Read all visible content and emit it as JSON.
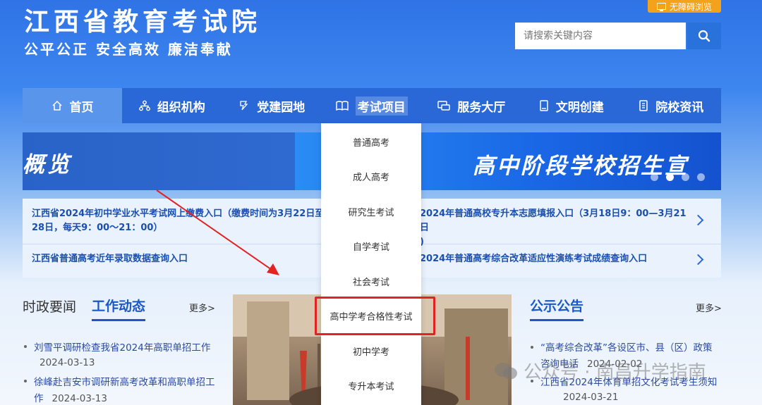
{
  "header": {
    "title": "江西省教育考试院",
    "slogan": "公平公正  安全高效  廉洁奉献",
    "accessibility_label": "无障碍浏览",
    "search_placeholder": "请搜索关键内容"
  },
  "nav": [
    {
      "label": "首页",
      "icon": "home-icon"
    },
    {
      "label": "组织机构",
      "icon": "org-chart-icon"
    },
    {
      "label": "党建园地",
      "icon": "party-building-icon"
    },
    {
      "label": "考试项目",
      "icon": "book-icon"
    },
    {
      "label": "服务大厅",
      "icon": "service-icon"
    },
    {
      "label": "文明创建",
      "icon": "tablet-icon"
    },
    {
      "label": "院校资讯",
      "icon": "document-icon"
    }
  ],
  "banner": {
    "left_text": "概览",
    "right_text": "高中阶段学校招生宣"
  },
  "quick_links": [
    {
      "line1": "江西省2024年初中学业水平考试网上缴费入口（缴费时间为3月22日至",
      "line2": "28日，每天9：00～21：00）"
    },
    {
      "line1": "2024年普通高校专升本志愿填报入口（3月18日9：00—3月21日",
      "line2": ")"
    },
    {
      "line1": "江西省普通高考近年录取数据查询入口",
      "line2": ""
    },
    {
      "line1": "2024年普通高考综合改革适应性演练考试成绩查询入口",
      "line2": ""
    }
  ],
  "news": {
    "tab_inactive": "时政要闻",
    "tab_active": "工作动态",
    "more": "更多>",
    "items": [
      {
        "title": "刘雪平调研检查我省2024年高职单招工作",
        "date": "2024-03-13"
      },
      {
        "title": "徐峰赴吉安市调研新高考改革和高职单招工",
        "title2": "作",
        "date": "2024-03-13"
      }
    ]
  },
  "notices": {
    "title": "公示公告",
    "more": "更多>",
    "items": [
      {
        "title": "“高考综合改革”各设区市、县（区）政策",
        "title2": "咨询电话",
        "date": "2024-02-02"
      },
      {
        "title": "江西省2024年体育单招文化考试考生须知",
        "date": "2024-03-21"
      }
    ]
  },
  "dropdown": {
    "items": [
      "普通高考",
      "成人高考",
      "研究生考试",
      "自学考试",
      "社会考试",
      "高中学考合格性考试",
      "初中学考",
      "专升本考试"
    ],
    "highlighted_index": 5
  },
  "watermark": "公众号 · 南昌升学指南",
  "colors": {
    "nav_bg": "#2a68d8",
    "highlight_box": "#e32222",
    "access_btn": "#f2a21b"
  }
}
